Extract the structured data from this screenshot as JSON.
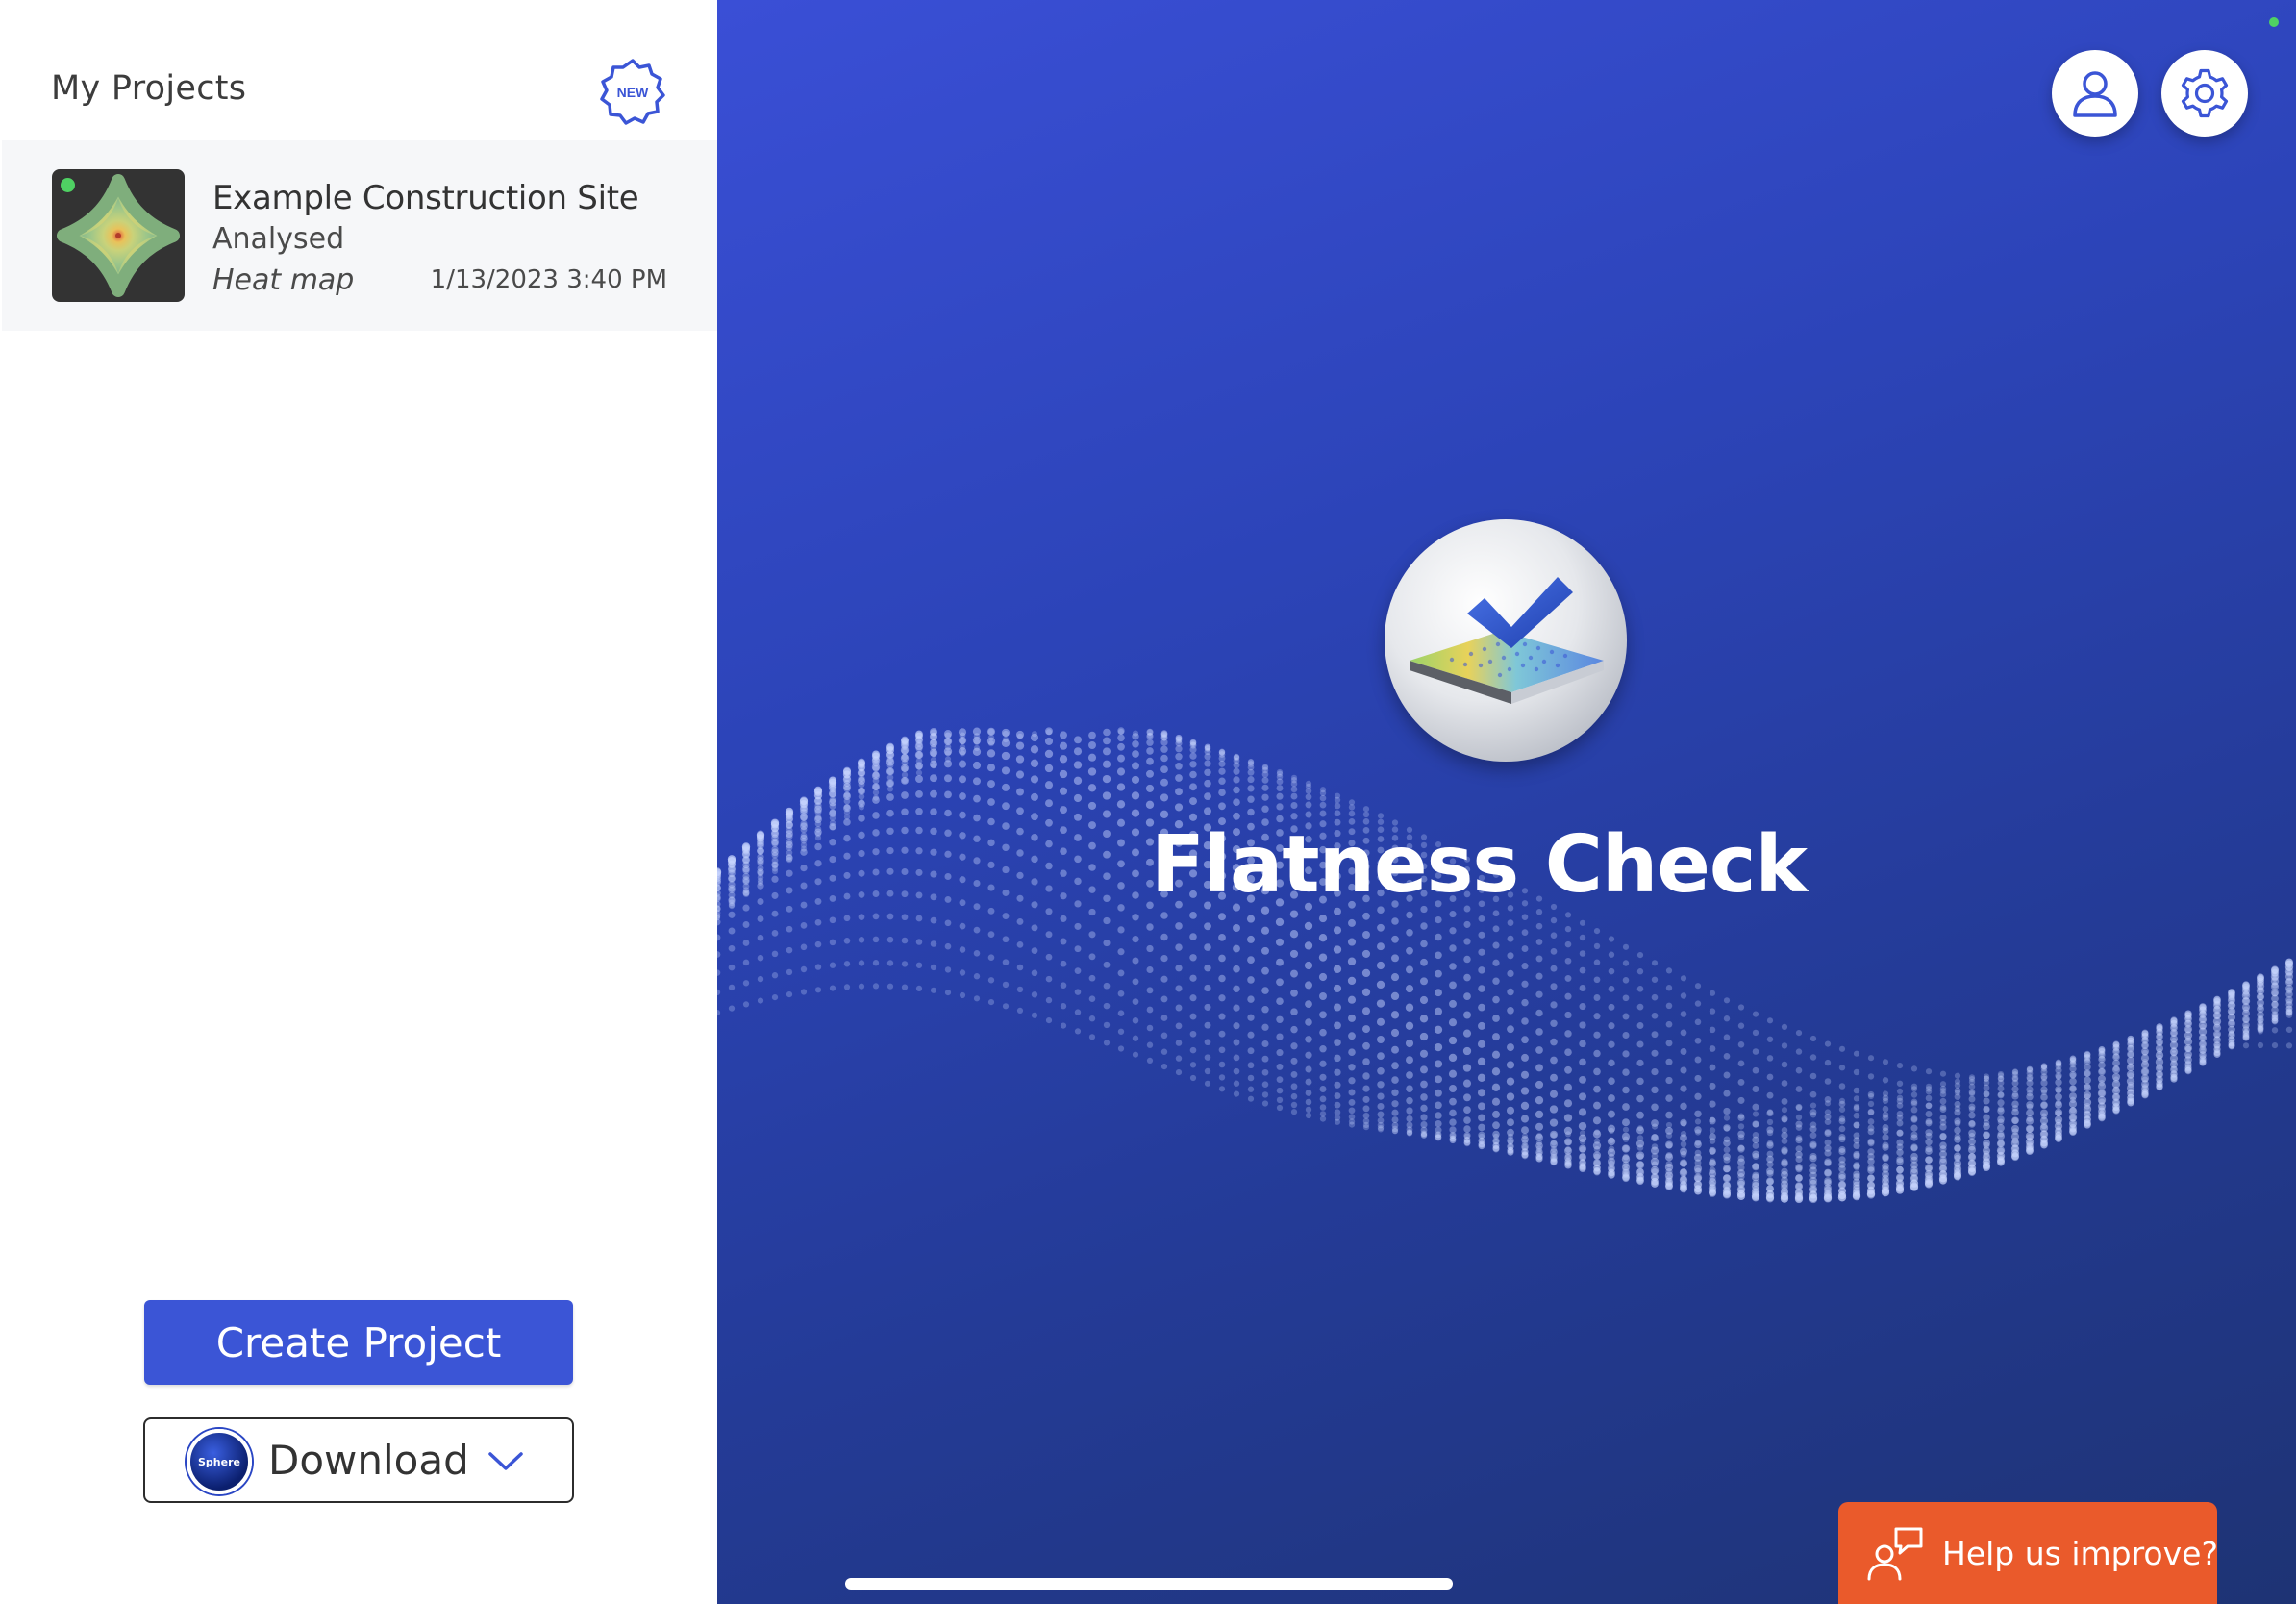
{
  "sidebar": {
    "title": "My Projects",
    "new_badge_label": "NEW",
    "projects": [
      {
        "name": "Example Construction Site",
        "status": "Analysed",
        "type": "Heat map",
        "date": "1/13/2023 3:40 PM"
      }
    ],
    "create_button_label": "Create Project",
    "download": {
      "label": "Download",
      "logo_text": "Sphere"
    }
  },
  "main": {
    "app_title": "Flatness Check",
    "help_button_label": "Help us improve?"
  },
  "icons": {
    "profile": "user-icon",
    "settings": "gear-icon",
    "help": "feedback-icon",
    "chevron": "chevron-down-icon"
  },
  "colors": {
    "accent": "#3b55d6",
    "help_orange": "#ea5a2b",
    "status_green": "#4fd163",
    "hero_blue": "#2c44b8"
  }
}
